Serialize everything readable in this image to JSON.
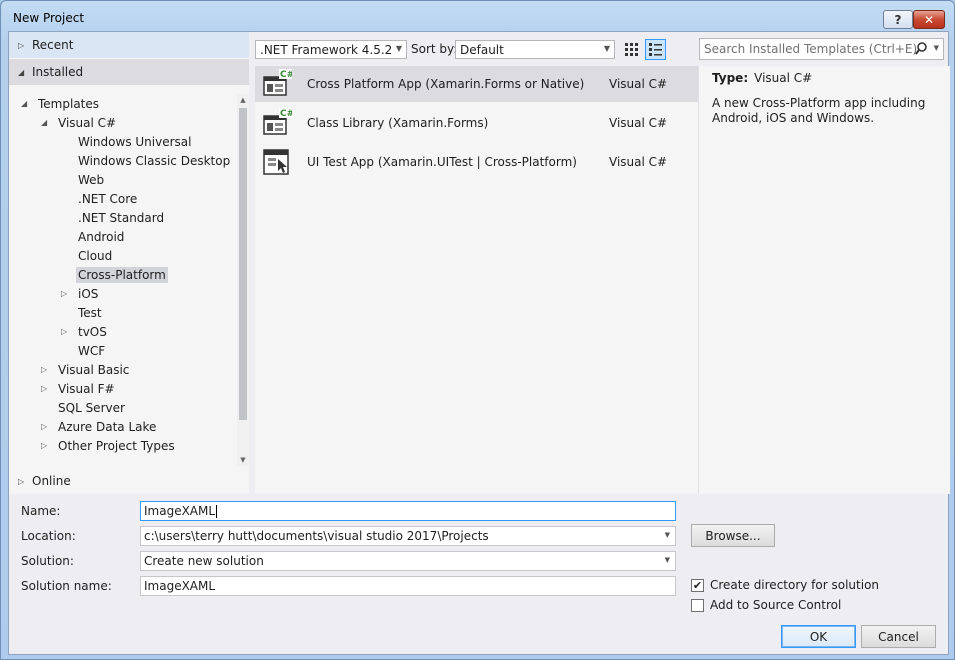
{
  "window": {
    "title": "New Project",
    "help": "?",
    "close": "✕"
  },
  "nav": {
    "recent": "Recent",
    "installed": "Installed",
    "online": "Online"
  },
  "tree": [
    {
      "label": "Templates",
      "twisty": "◢",
      "indent": 0
    },
    {
      "label": "Visual C#",
      "twisty": "◢",
      "indent": 1
    },
    {
      "label": "Windows Universal",
      "twisty": "",
      "indent": 2
    },
    {
      "label": "Windows Classic Desktop",
      "twisty": "",
      "indent": 2
    },
    {
      "label": "Web",
      "twisty": "",
      "indent": 2
    },
    {
      "label": ".NET Core",
      "twisty": "",
      "indent": 2
    },
    {
      "label": ".NET Standard",
      "twisty": "",
      "indent": 2
    },
    {
      "label": "Android",
      "twisty": "",
      "indent": 2
    },
    {
      "label": "Cloud",
      "twisty": "",
      "indent": 2
    },
    {
      "label": "Cross-Platform",
      "twisty": "",
      "indent": 2,
      "selected": true
    },
    {
      "label": "iOS",
      "twisty": "▷",
      "indent": 2
    },
    {
      "label": "Test",
      "twisty": "",
      "indent": 2
    },
    {
      "label": "tvOS",
      "twisty": "▷",
      "indent": 2
    },
    {
      "label": "WCF",
      "twisty": "",
      "indent": 2
    },
    {
      "label": "Visual Basic",
      "twisty": "▷",
      "indent": 1
    },
    {
      "label": "Visual F#",
      "twisty": "▷",
      "indent": 1
    },
    {
      "label": "SQL Server",
      "twisty": "",
      "indent": 1
    },
    {
      "label": "Azure Data Lake",
      "twisty": "▷",
      "indent": 1
    },
    {
      "label": "Other Project Types",
      "twisty": "▷",
      "indent": 1
    }
  ],
  "toolbar": {
    "framework": ".NET Framework 4.5.2",
    "sort_label": "Sort by:",
    "sort_value": "Default",
    "search_placeholder": "Search Installed Templates (Ctrl+E)"
  },
  "templates": [
    {
      "name": "Cross Platform App (Xamarin.Forms or Native)",
      "lang": "Visual C#",
      "icon": "cross-platform-app-icon",
      "selected": true
    },
    {
      "name": "Class Library (Xamarin.Forms)",
      "lang": "Visual C#",
      "icon": "class-library-icon",
      "selected": false
    },
    {
      "name": "UI Test App (Xamarin.UITest | Cross-Platform)",
      "lang": "Visual C#",
      "icon": "ui-test-app-icon",
      "selected": false
    }
  ],
  "details": {
    "type_label": "Type:",
    "type_value": "Visual C#",
    "description": "A new Cross-Platform app including Android, iOS and Windows."
  },
  "form": {
    "name_label": "Name:",
    "name_value": "ImageXAML",
    "location_label": "Location:",
    "location_value": "c:\\users\\terry hutt\\documents\\visual studio 2017\\Projects",
    "solution_label": "Solution:",
    "solution_value": "Create new solution",
    "solution_name_label": "Solution name:",
    "solution_name_value": "ImageXAML",
    "browse": "Browse...",
    "create_dir": "Create directory for solution",
    "create_dir_checked": true,
    "source_control": "Add to Source Control",
    "source_control_checked": false,
    "ok": "OK",
    "cancel": "Cancel"
  },
  "colors": {
    "accent": "#3399ff",
    "selection": "#dbdbe0",
    "csharp_green": "#68a063"
  }
}
